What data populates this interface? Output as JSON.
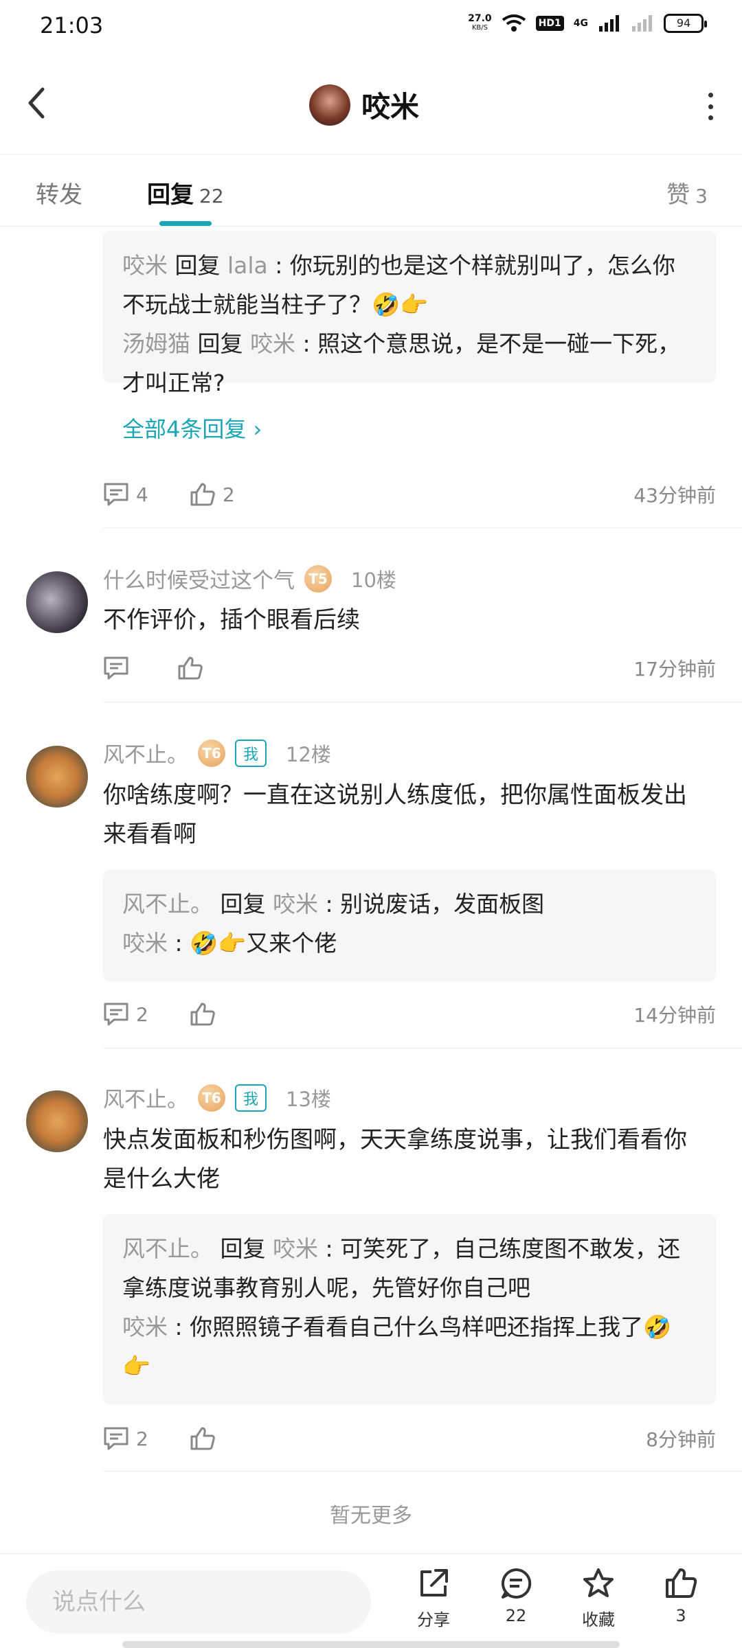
{
  "status_bar": {
    "time": "21:03",
    "net_speed": "27.0",
    "net_unit": "KB/S",
    "hd": "HD1",
    "signal": "4G",
    "battery": "94"
  },
  "header": {
    "title": "咬米"
  },
  "tabs": {
    "forward": "转发",
    "reply": "回复",
    "reply_count": "22",
    "like": "赞",
    "like_count": "3"
  },
  "thread_top": {
    "replies": [
      {
        "user": "咬米",
        "verb": "回复",
        "target": "lala",
        "text": ": 你玩别的也是这个样就别叫了，怎么你不玩战士就能当柱子了？🤣👉"
      },
      {
        "user": "汤姆猫",
        "verb": "回复",
        "target": "咬米",
        "text": ": 照这个意思说，是不是一碰一下死，才叫正常?"
      }
    ],
    "all_replies": "全部4条回复 ›",
    "comment_count": "4",
    "like_count": "2",
    "time": "43分钟前"
  },
  "posts": [
    {
      "user": "什么时候受过这个气",
      "level": "T5",
      "floor": "10楼",
      "text": "不作评价，插个眼看后续",
      "comment_count": "",
      "like_count": "",
      "time": "17分钟前"
    },
    {
      "user": "风不止。",
      "level": "T6",
      "me_badge": "我",
      "floor": "12楼",
      "text": "你啥练度啊？一直在这说别人练度低，把你属性面板发出来看看啊",
      "replies": [
        {
          "user": "风不止。",
          "verb": "回复",
          "target": "咬米",
          "text": ": 别说废话，发面板图"
        },
        {
          "user": "咬米",
          "text": ": 🤣👉又来个佬"
        }
      ],
      "comment_count": "2",
      "time": "14分钟前"
    },
    {
      "user": "风不止。",
      "level": "T6",
      "me_badge": "我",
      "floor": "13楼",
      "text": "快点发面板和秒伤图啊，天天拿练度说事，让我们看看你是什么大佬",
      "replies": [
        {
          "user": "风不止。",
          "verb": "回复",
          "target": "咬米",
          "text": ": 可笑死了，自己练度图不敢发，还拿练度说事教育别人呢，先管好你自己吧"
        },
        {
          "user": "咬米",
          "text": ": 你照照镜子看看自己什么鸟样吧还指挥上我了🤣👉"
        }
      ],
      "comment_count": "2",
      "time": "8分钟前"
    }
  ],
  "no_more": "暂无更多",
  "bottom_bar": {
    "input_placeholder": "说点什么",
    "share": "分享",
    "comments": "22",
    "favorite": "收藏",
    "likes": "3"
  }
}
